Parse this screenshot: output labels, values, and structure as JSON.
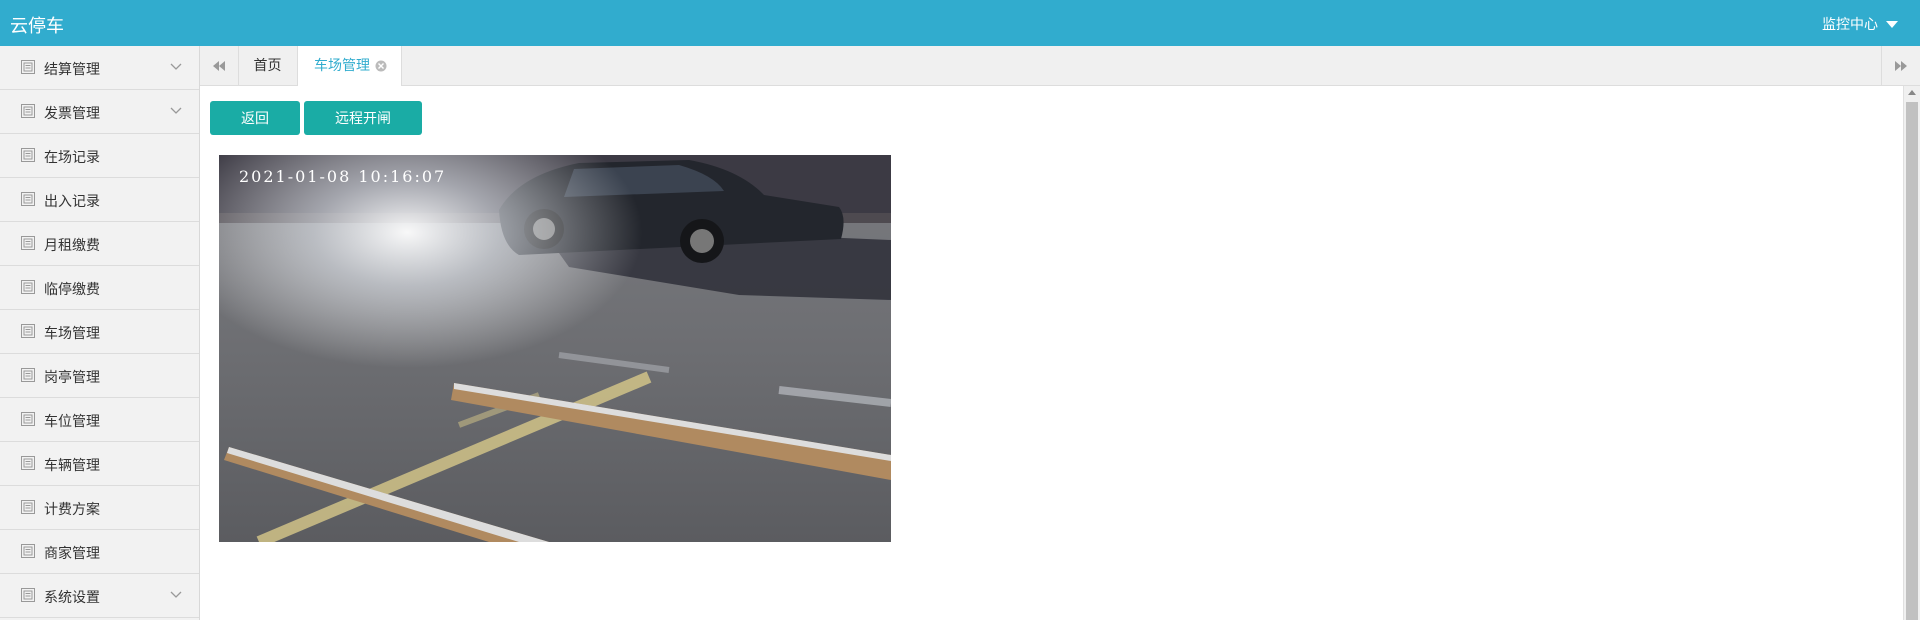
{
  "header": {
    "app_title": "云停车",
    "menu_label": "监控中心"
  },
  "sidebar": {
    "items": [
      {
        "label": "结算管理",
        "expandable": true
      },
      {
        "label": "发票管理",
        "expandable": true
      },
      {
        "label": "在场记录",
        "expandable": false
      },
      {
        "label": "出入记录",
        "expandable": false
      },
      {
        "label": "月租缴费",
        "expandable": false
      },
      {
        "label": "临停缴费",
        "expandable": false
      },
      {
        "label": "车场管理",
        "expandable": false
      },
      {
        "label": "岗亭管理",
        "expandable": false
      },
      {
        "label": "车位管理",
        "expandable": false
      },
      {
        "label": "车辆管理",
        "expandable": false
      },
      {
        "label": "计费方案",
        "expandable": false
      },
      {
        "label": "商家管理",
        "expandable": false
      },
      {
        "label": "系统设置",
        "expandable": true
      }
    ]
  },
  "tabs": {
    "home": "首页",
    "active": "车场管理"
  },
  "toolbar": {
    "back_label": "返回",
    "remote_open_label": "远程开闸"
  },
  "camera": {
    "timestamp": "2021-01-08  10:16:07"
  },
  "colors": {
    "header_bg": "#31acce",
    "button_bg": "#1aaca5",
    "active_tab": "#31acce"
  }
}
